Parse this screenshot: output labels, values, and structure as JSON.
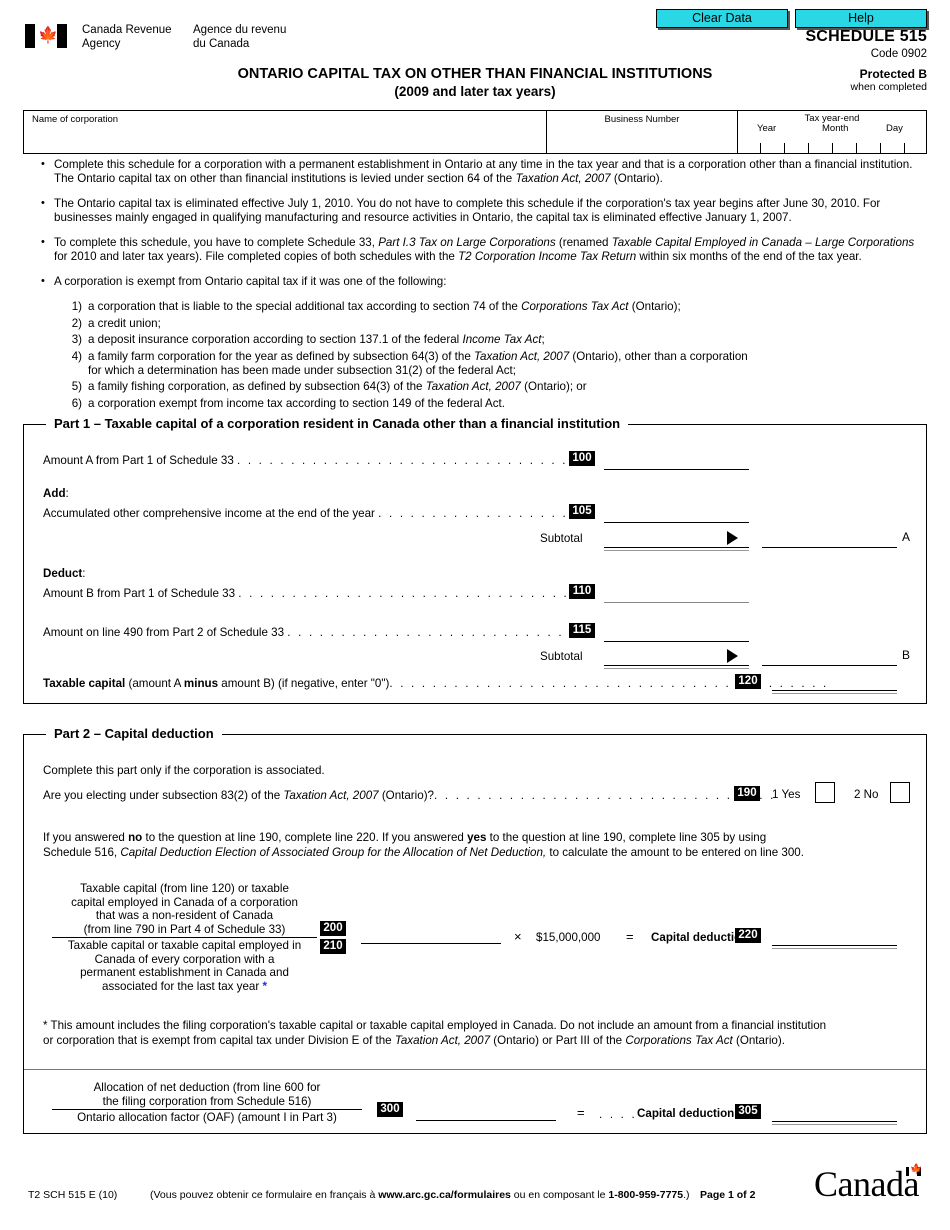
{
  "toolbar": {
    "clear_data_label": "Clear Data",
    "help_label": "Help",
    "button_color": "#2ad7e4"
  },
  "header": {
    "agency_en_line1": "Canada Revenue",
    "agency_en_line2": "Agency",
    "agency_fr_line1": "Agence du revenu",
    "agency_fr_line2": "du Canada",
    "schedule": "SCHEDULE 515",
    "code": "Code 0902",
    "protected": "Protected B",
    "protected_sub": "when completed",
    "form_title": "ONTARIO CAPITAL TAX ON OTHER THAN FINANCIAL INSTITUTIONS",
    "form_subtitle": "(2009 and later tax years)"
  },
  "identification": {
    "name_label": "Name of corporation",
    "name_value": "",
    "business_number_label": "Business Number",
    "business_number_value": "",
    "tax_year_end_label": "Tax year-end",
    "year_label": "Year",
    "month_label": "Month",
    "day_label": "Day"
  },
  "instructions": {
    "bullets": [
      "Complete this schedule for a corporation with a permanent establishment in Ontario at any time in the tax year and that is a corporation other than a financial institution. The Ontario capital tax on other than financial institutions is levied under section 64 of the Taxation Act, 2007 (Ontario).",
      "The Ontario capital tax is eliminated effective July 1, 2010. You do not have to complete this schedule if the corporation's tax year begins after June 30, 2010. For businesses mainly engaged in qualifying manufacturing and resource activities in Ontario, the capital tax is eliminated effective January 1, 2007.",
      "To complete this schedule, you have to complete Schedule 33, Part I.3 Tax on Large Corporations (renamed Taxable Capital Employed in Canada – Large Corporations for 2010 and later tax years). File completed copies of both schedules with the T2 Corporation Income Tax Return within six months of the end of the tax year.",
      "A corporation is exempt from Ontario capital tax if it was one of the following:"
    ],
    "exemptions": [
      {
        "n": "1)",
        "text": "a corporation that is liable to the special additional tax according to section 74 of the Corporations Tax Act (Ontario);"
      },
      {
        "n": "2)",
        "text": "a credit union;"
      },
      {
        "n": "3)",
        "text": "a deposit insurance corporation according to section 137.1 of the federal Income Tax Act;"
      },
      {
        "n": "4)",
        "text": "a family farm corporation for the year as defined by subsection 64(3) of the Taxation Act, 2007 (Ontario), other than a corporation for which a determination has been made under subsection 31(2) of the federal Act;"
      },
      {
        "n": "5)",
        "text": "a family fishing corporation, as defined by subsection 64(3) of the Taxation Act, 2007 (Ontario); or"
      },
      {
        "n": "6)",
        "text": "a corporation exempt from income tax according to section 149 of the federal Act."
      }
    ]
  },
  "part1": {
    "legend": "Part 1 – Taxable capital of a corporation resident in Canada other than a financial institution",
    "row_100_label": "Amount A from Part 1 of Schedule 33",
    "row_100_dots": ". . . . . . . . . . . . . . . . . . . . . . . . . . . . . . . . .",
    "line_100": "100",
    "line_100_value": "",
    "add_label": "Add",
    "add_colon": ":",
    "row_105_label": "Accumulated other comprehensive income at the end of the year",
    "row_105_dots": ". . . . . . . . . . . . . . . . . . .",
    "line_105": "105",
    "line_105_value": "",
    "subtotal_label": "Subtotal",
    "subtotal_a_value": "",
    "amount_a_letter": "A",
    "amount_a_value": "",
    "deduct_label": "Deduct",
    "deduct_colon": ":",
    "row_110_label": "Amount B from Part 1 of Schedule 33",
    "row_110_dots": ". . . . . . . . . . . . . . . . . . . . . . . . . . . . . . . . .",
    "line_110": "110",
    "line_110_value": "",
    "row_115_label": "Amount on line 490 from Part 2 of Schedule 33",
    "row_115_dots": ". . . . . . . . . . . . . . . . . . . . . . . . . . . .",
    "line_115": "115",
    "line_115_value": "",
    "subtotal_b_value": "",
    "amount_b_letter": "B",
    "amount_b_value": "",
    "taxable_capital_bold": "Taxable capital",
    "taxable_capital_rest_1": " (amount A ",
    "taxable_capital_minus": "minus",
    "taxable_capital_rest_2": " amount B) (if negative, enter \"0\")",
    "taxable_capital_dots": ". . . . . . . . . . . . . . . . . . . . . . . . . . . . . . . . . . . . . . . . .",
    "line_120": "120",
    "line_120_value": ""
  },
  "part2": {
    "legend": "Part 2 – Capital deduction",
    "intro": "Complete this part only if the corporation is associated.",
    "q_190_text_1": "Are you electing under subsection 83(2) of the ",
    "q_190_italic": "Taxation Act, 2007",
    "q_190_text_2": " (Ontario)?",
    "q_190_dots": ". . . . . . . . . . . . . . . . . . . . . . . . . . . . . . . .",
    "line_190": "190",
    "yes_label": "1 Yes",
    "no_label": "2 No",
    "yes_checked": false,
    "no_checked": false,
    "note_1a": "If you answered ",
    "note_1b": "no",
    "note_1c": " to the question at line 190, complete line 220. If you answered ",
    "note_1d": "yes",
    "note_1e": " to the question at line 190, complete line 305 by using",
    "note_2a": "Schedule 516, ",
    "note_2b": "Capital Deduction Election of Associated Group for the Allocation of Net Deduction,",
    "note_2c": " to calculate the amount to be entered on line 300.",
    "numerator_lines": [
      "Taxable capital (from line 120) or taxable",
      "capital employed in Canada of a corporation",
      "that was a non-resident of Canada",
      "(from line 790 in Part 4 of Schedule 33)"
    ],
    "denominator_lines": [
      "Taxable capital or taxable capital employed in",
      "Canada of every corporation with a",
      "permanent establishment in Canada and",
      "associated for the last tax year"
    ],
    "denominator_asterisk": "*",
    "line_200": "200",
    "line_210": "210",
    "line_200_value": "",
    "multiply_symbol": "×",
    "constant_amount": "$15,000,000",
    "equals_symbol": "=",
    "capital_deduction_label": "Capital deduction",
    "line_220": "220",
    "line_220_value": "",
    "footnote_1": "* This amount includes the filing corporation's taxable capital or taxable capital employed in Canada. Do not include an amount from a financial institution",
    "footnote_2a": "or corporation that is exempt from capital tax under Division E of the ",
    "footnote_2b": "Taxation Act, 2007",
    "footnote_2c": " (Ontario) or Part III of the ",
    "footnote_2d": "Corporations Tax Act",
    "footnote_2e": " (Ontario).",
    "alloc_num_1": "Allocation of net deduction (from line 600 for",
    "alloc_num_2": "the filing corporation from Schedule 516)",
    "alloc_den": "Ontario allocation factor (OAF) (amount I in Part 3)",
    "line_300": "300",
    "line_300_value": "",
    "equals_symbol_2": "=",
    "dots_2": ". . . .",
    "capital_deduction_label_2": "Capital deduction",
    "line_305": "305",
    "line_305_value": ""
  },
  "footer": {
    "form_code": "T2 SCH 515 E (10)",
    "french_note_1": "(Vous pouvez obtenir ce formulaire en français à ",
    "french_note_url": "www.arc.gc.ca/formulaires",
    "french_note_2": " ou en composant le ",
    "french_note_phone": "1-800-959-7775",
    "french_note_3": ".)",
    "page_label": "Page 1 of 2",
    "wordmark": "Canada"
  }
}
